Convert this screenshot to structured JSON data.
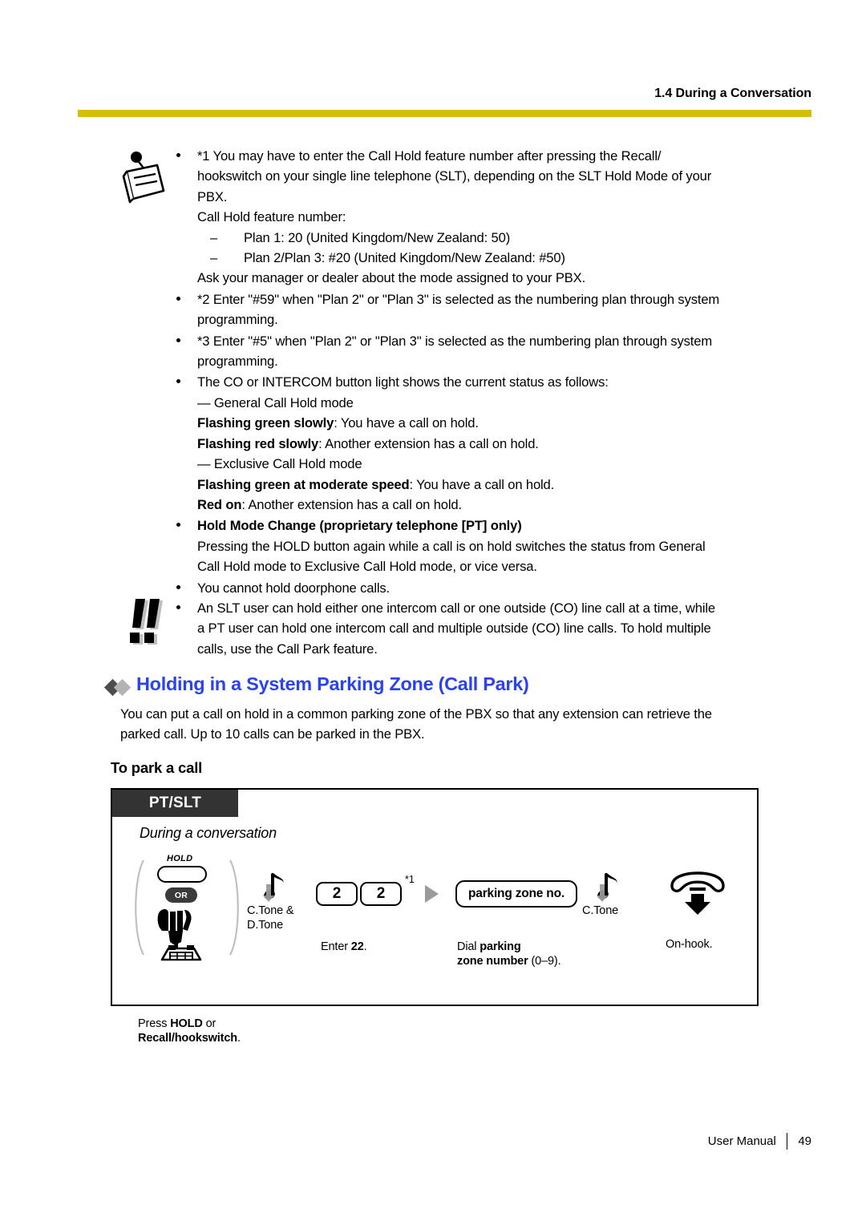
{
  "header": {
    "section_title": "1.4 During a Conversation",
    "rule_color": "#d6bd06"
  },
  "note_block": {
    "icon": "memo-icon",
    "bullets": [
      {
        "marker": "*1",
        "lines": [
          "*1 You may have to enter the Call Hold feature number after pressing the Recall/",
          "hookswitch on your single line telephone (SLT), depending on the SLT Hold Mode of your",
          "PBX.",
          "Call Hold feature number:"
        ],
        "sub_items": [
          "Plan 1: 20 (United Kingdom/New Zealand: 50)",
          "Plan 2/Plan 3: #20 (United Kingdom/New Zealand: #50)"
        ],
        "tail": "Ask your manager or dealer about the mode assigned to your PBX."
      },
      {
        "marker": "*2",
        "lines": [
          "*2 Enter \"#59\" when \"Plan 2\" or \"Plan 3\" is selected as the numbering plan through system",
          "programming."
        ]
      },
      {
        "marker": "*3",
        "lines": [
          "*3 Enter \"#5\" when \"Plan 2\" or \"Plan 3\" is selected as the numbering plan through system",
          "programming."
        ]
      }
    ],
    "status_bullet": {
      "intro": "The CO or INTERCOM button light shows the current status as follows:",
      "mode1_label": "— General Call Hold mode",
      "mode1_states": [
        {
          "bold": "Flashing green slowly",
          "rest": ": You have a call on hold."
        },
        {
          "bold": "Flashing red slowly",
          "rest": ": Another extension has a call on hold."
        }
      ],
      "mode2_label": "— Exclusive Call Hold mode",
      "mode2_states": [
        {
          "bold": "Flashing green at moderate speed",
          "rest": ": You have a call on hold."
        },
        {
          "bold": "Red on",
          "rest": ": Another extension has a call on hold."
        }
      ]
    },
    "hold_mode_bullet": {
      "title": "Hold Mode Change (proprietary telephone [PT] only)",
      "lines": [
        "Pressing the HOLD button again while a call is on hold switches the status from General",
        "Call Hold mode to Exclusive Call Hold mode, or vice versa."
      ]
    },
    "last_bullet": "You cannot hold doorphone calls."
  },
  "caution_block": {
    "icon": "caution-double-exclamation-icon",
    "lines": [
      "An SLT user can hold either one intercom call or one outside (CO) line call at a time, while",
      "a PT user can hold one intercom call and multiple outside (CO) line calls. To hold multiple",
      "calls, use the Call Park feature."
    ]
  },
  "section": {
    "heading": "Holding in a System Parking Zone (Call Park)",
    "heading_color": "#2a42ef",
    "diamond_dark": "#4d4d4d",
    "diamond_light": "#b3b3b3",
    "body_lines": [
      "You can put a call on hold in a common parking zone of the PBX so that any extension can retrieve the",
      "parked call. Up to 10 calls can be parked in the PBX."
    ],
    "sub_heading": "To park a call"
  },
  "diagram": {
    "tag": "PT/SLT",
    "tag_bg": "#333333",
    "state": "During a conversation",
    "steps": [
      {
        "id": "hold-or-recall",
        "hold_label": "HOLD",
        "or_label": "OR",
        "caption_pre": "Press ",
        "caption_bold": "HOLD",
        "caption_mid": " or",
        "caption_bold2": "Recall/hookswitch",
        "caption_post": "."
      },
      {
        "id": "tone-confirmation-dial",
        "tone_line1": "C.Tone &",
        "tone_line2": "D.Tone"
      },
      {
        "id": "enter-22",
        "keys": [
          "2",
          "2"
        ],
        "footnote": "*1",
        "caption_pre": "Enter ",
        "caption_bold": "22",
        "caption_post": "."
      },
      {
        "id": "arrow",
        "glyph": "triangle-right-icon",
        "color": "#9a9a9a"
      },
      {
        "id": "parking-zone-no",
        "box_label": "parking zone no.",
        "caption_pre": "Dial ",
        "caption_bold": "parking",
        "caption_bold2": "zone number",
        "caption_post": " (0–9)."
      },
      {
        "id": "tone-confirmation",
        "tone_line1": "C.Tone"
      },
      {
        "id": "on-hook",
        "caption": "On-hook."
      }
    ]
  },
  "footer": {
    "label": "User Manual",
    "page": "49"
  }
}
